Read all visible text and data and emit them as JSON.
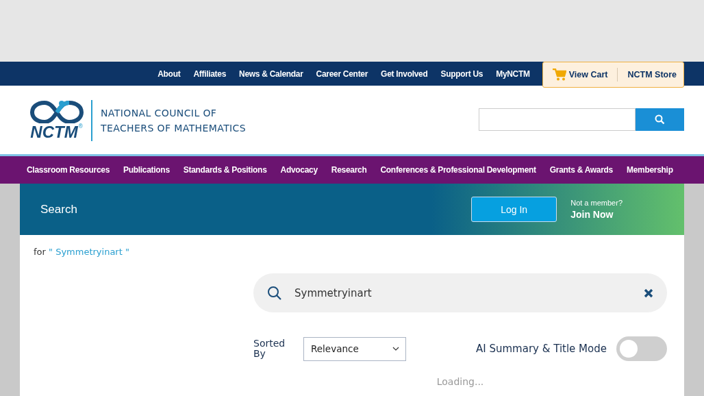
{
  "utility_nav": {
    "links": [
      "About",
      "Affiliates",
      "News & Calendar",
      "Career Center",
      "Get Involved",
      "Support Us",
      "MyNCTM"
    ],
    "cart": "View Cart",
    "store": "NCTM Store"
  },
  "logo": {
    "acronym": "NCTM",
    "mark": "®",
    "line1": "NATIONAL COUNCIL OF",
    "line2": "TEACHERS OF MATHEMATICS"
  },
  "main_nav": [
    "Classroom Resources",
    "Publications",
    "Standards & Positions",
    "Advocacy",
    "Research",
    "Conferences & Professional Development",
    "Grants & Awards",
    "Membership"
  ],
  "banner": {
    "title": "Search",
    "login": "Log In",
    "prompt": "Not a member?",
    "join": "Join Now"
  },
  "query_note": {
    "prefix": "for",
    "query": "\" Symmetryinart \""
  },
  "search": {
    "value": "Symmetryinart"
  },
  "sort": {
    "label": "Sorted By",
    "value": "Relevance"
  },
  "ai_mode": {
    "label": "AI Summary & Title Mode",
    "on": false
  },
  "status": "Loading..."
}
